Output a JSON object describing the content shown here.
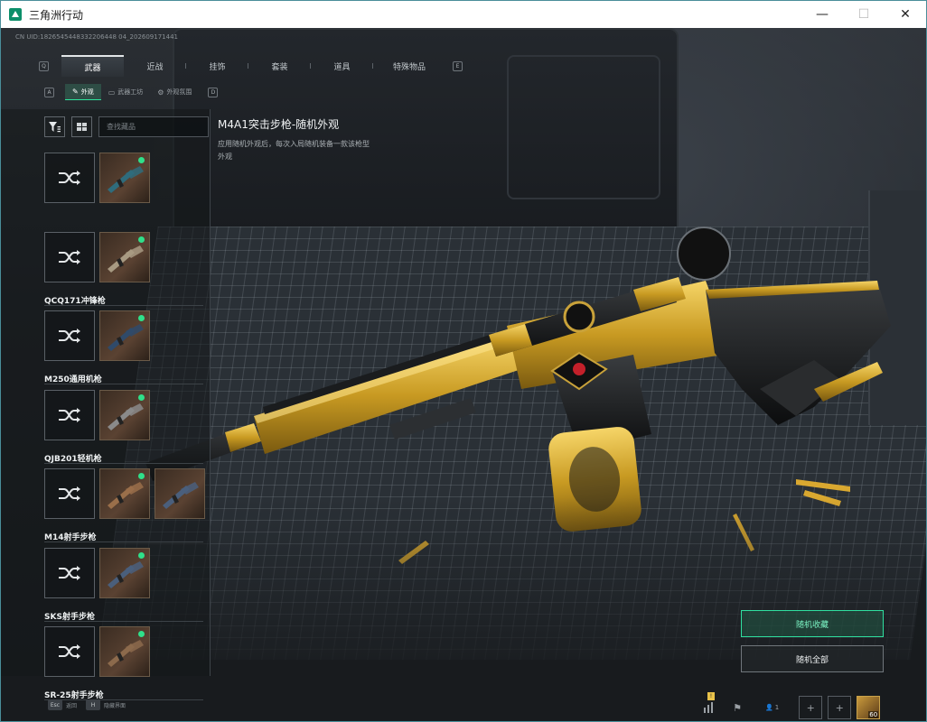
{
  "window": {
    "title": "三角洲行动",
    "minimize": "—",
    "maximize": "☐",
    "close": "✕"
  },
  "uid": "CN UID:1826545448332206448 04_202609171441",
  "main_tabs": {
    "prev_key": "Q",
    "next_key": "E",
    "items": [
      {
        "label": "武器",
        "active": true
      },
      {
        "label": "近战",
        "active": false
      },
      {
        "label": "挂饰",
        "active": false
      },
      {
        "label": "套装",
        "active": false
      },
      {
        "label": "道具",
        "active": false
      },
      {
        "label": "特殊物品",
        "active": false
      }
    ]
  },
  "sub_tabs": {
    "prev_key": "A",
    "next_key": "D",
    "items": [
      {
        "label": "外观",
        "icon": "brush-icon",
        "active": true
      },
      {
        "label": "武器工坊",
        "icon": "workshop-icon",
        "active": false
      },
      {
        "label": "外观氛围",
        "icon": "gear-icon",
        "active": false
      }
    ]
  },
  "search": {
    "placeholder": "查找藏品"
  },
  "weapons": [
    {
      "name": "",
      "skins": 1
    },
    {
      "name": "QCQ171冲锋枪",
      "skins": 1
    },
    {
      "name": "M250通用机枪",
      "skins": 1
    },
    {
      "name": "QJB201轻机枪",
      "skins": 1
    },
    {
      "name": "M14射手步枪",
      "skins": 2
    },
    {
      "name": "SKS射手步枪",
      "skins": 1
    },
    {
      "name": "SR-25射手步枪",
      "skins": 1
    }
  ],
  "selected_weapon": {
    "title": "M4A1突击步枪-随机外观",
    "description": "应用随机外观后，每次入局随机装备一款该枪型外观"
  },
  "actions": {
    "random_favorites": "随机收藏",
    "random_all": "随机全部"
  },
  "bottom_hints": [
    {
      "key": "Esc",
      "label": "返回"
    },
    {
      "key": "H",
      "label": "隐藏界面"
    }
  ],
  "bottom_right": {
    "stats_badge": "!",
    "friends_count": "1",
    "level": "60"
  },
  "colors": {
    "accent_green": "#2fe08a",
    "gold": "#d9b13a",
    "titlebar": "#ffffff"
  }
}
